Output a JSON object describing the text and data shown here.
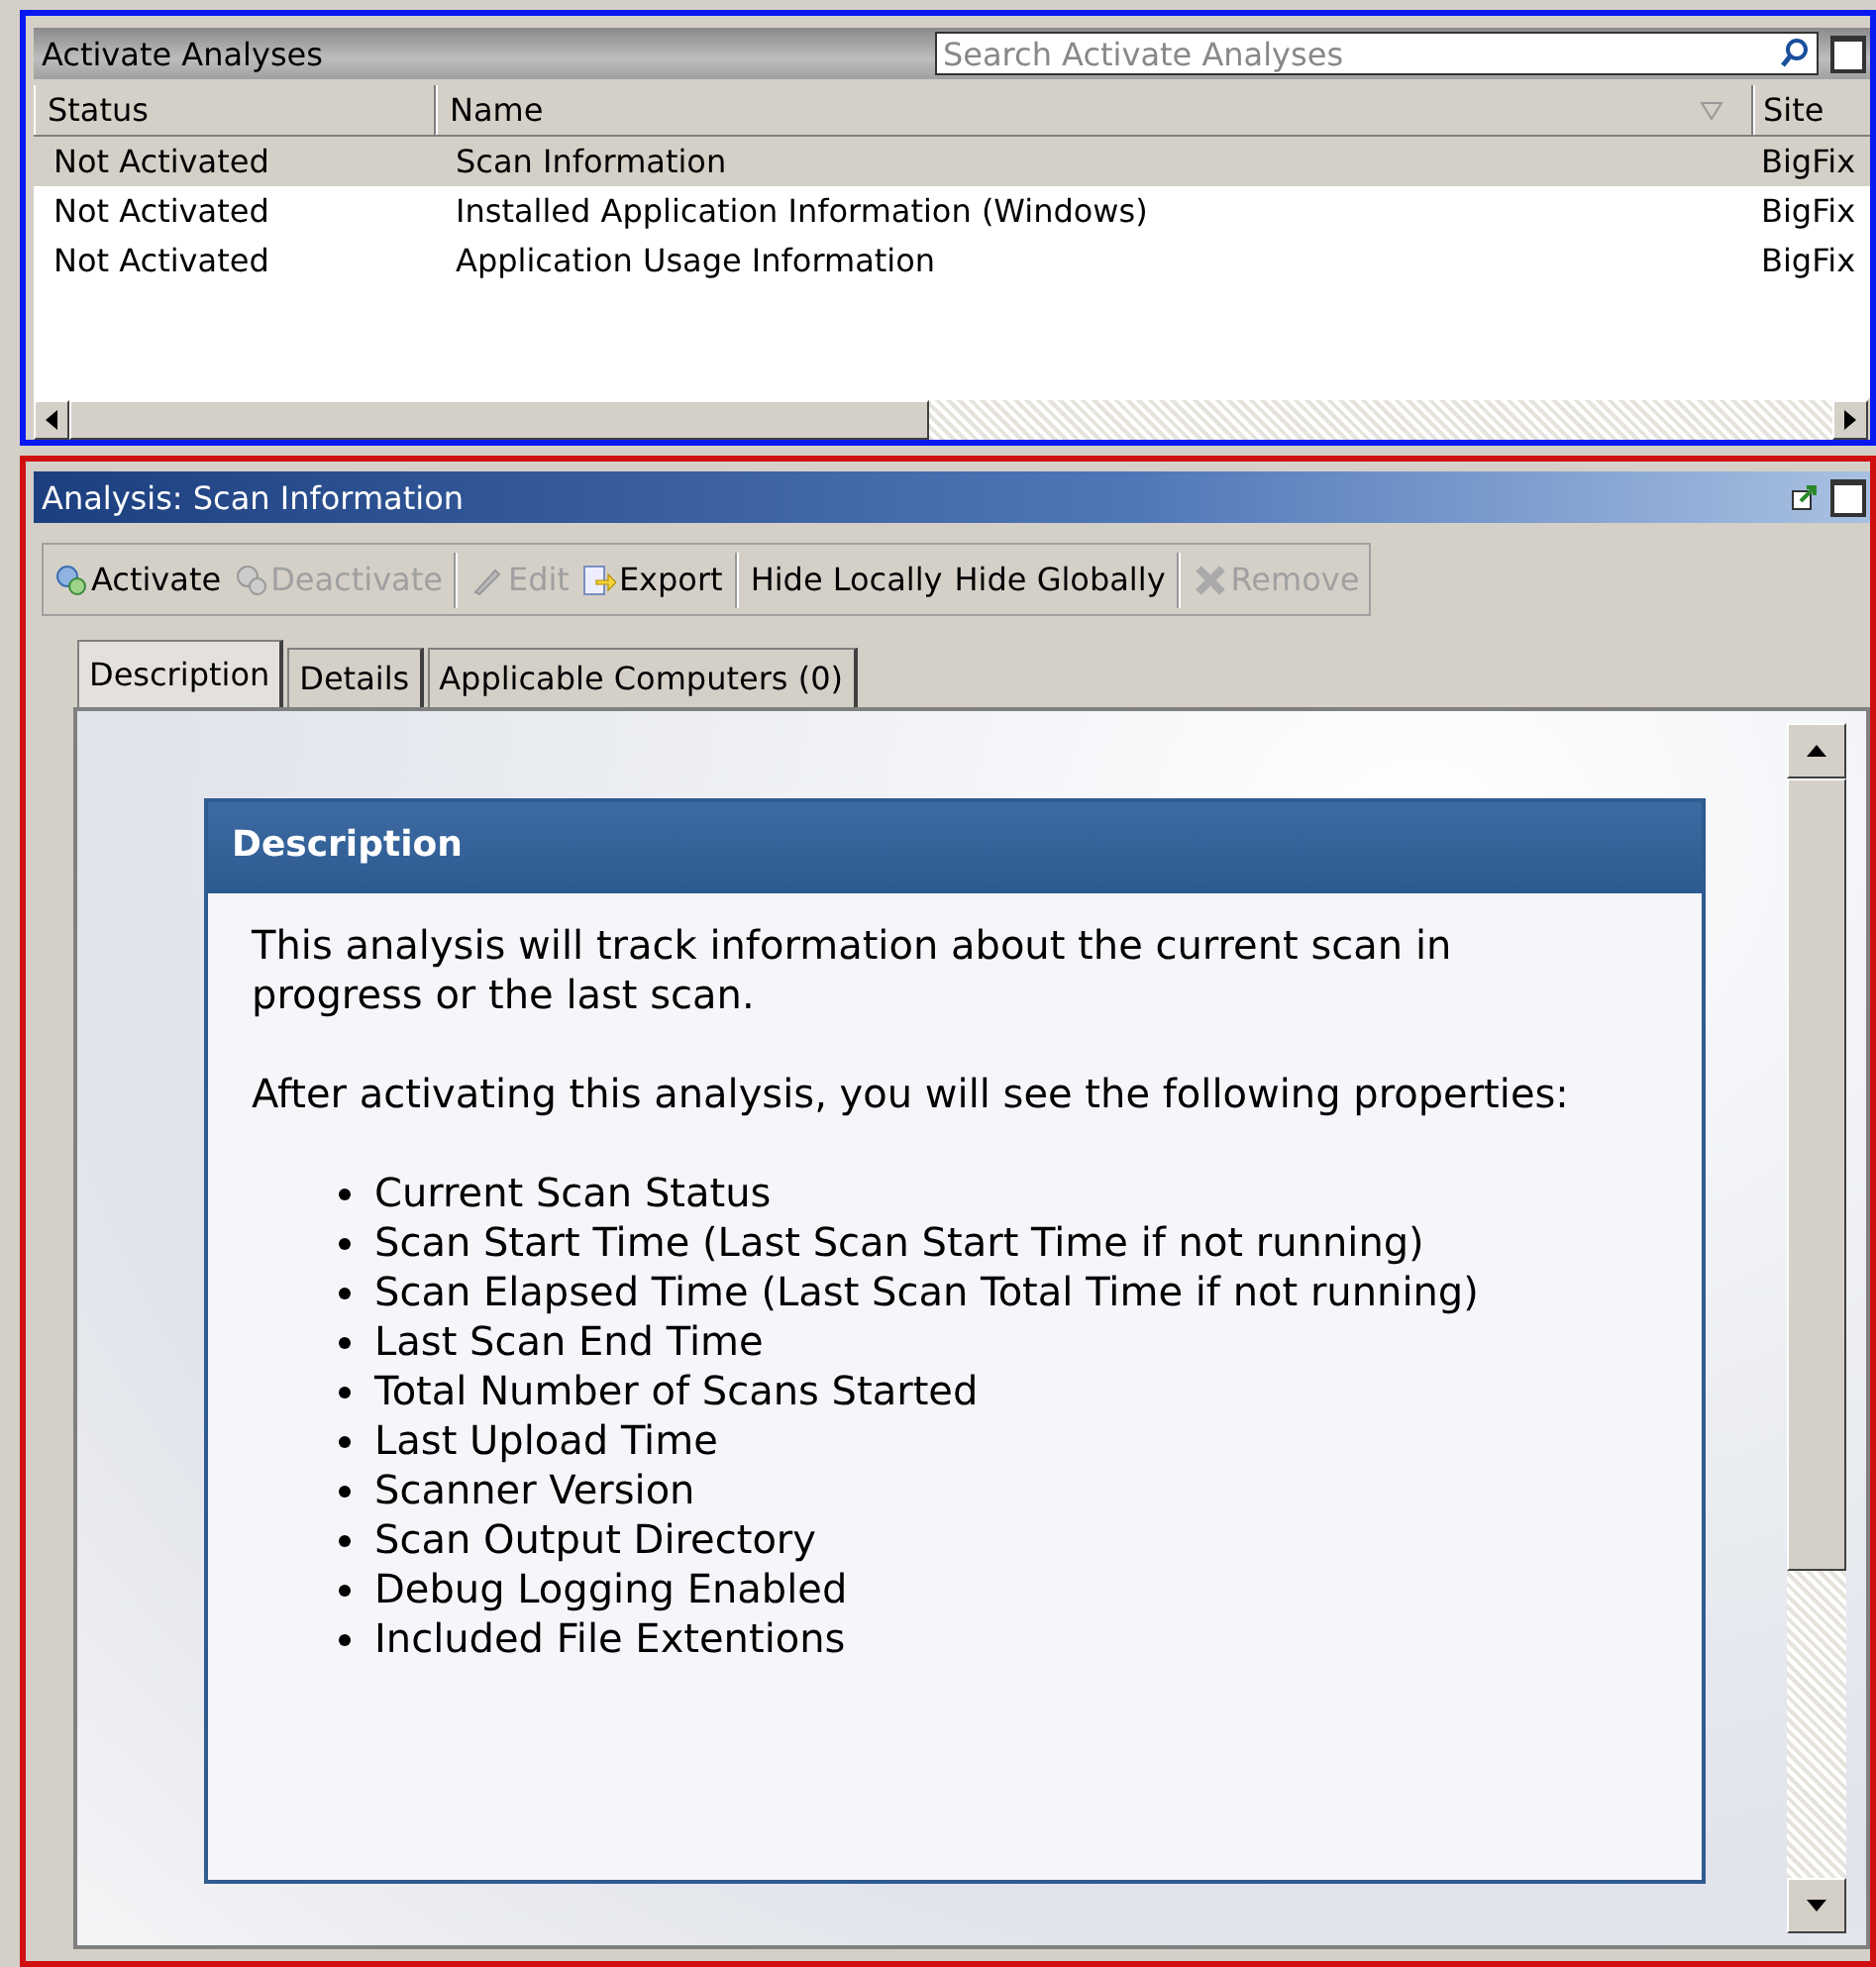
{
  "analyses_panel": {
    "title": "Activate Analyses",
    "search": {
      "placeholder": "Search Activate Analyses"
    },
    "table": {
      "columns": [
        {
          "label": "Status",
          "sorted": false
        },
        {
          "label": "Name",
          "sorted": true
        },
        {
          "label": "Site",
          "sorted": false
        }
      ],
      "rows": [
        {
          "cells": [
            "Not Activated",
            "Scan Information",
            "BigFix"
          ],
          "selected": true
        },
        {
          "cells": [
            "Not Activated",
            "Installed Application Information (Windows)",
            "BigFix"
          ],
          "selected": false
        },
        {
          "cells": [
            "Not Activated",
            "Application Usage Information",
            "BigFix"
          ],
          "selected": false
        }
      ]
    }
  },
  "analysis_panel": {
    "title": "Analysis: Scan Information",
    "toolbar": [
      {
        "kind": "icon-button",
        "label": "Activate",
        "disabled": false
      },
      {
        "kind": "icon-button",
        "label": "Deactivate",
        "disabled": true
      },
      {
        "kind": "separator"
      },
      {
        "kind": "icon-button",
        "label": "Edit",
        "disabled": true
      },
      {
        "kind": "icon-button",
        "label": "Export",
        "disabled": false
      },
      {
        "kind": "separator"
      },
      {
        "kind": "text-button",
        "label": "Hide Locally",
        "disabled": false
      },
      {
        "kind": "text-button",
        "label": "Hide Globally",
        "disabled": false
      },
      {
        "kind": "separator"
      },
      {
        "kind": "icon-button",
        "label": "Remove",
        "disabled": true
      }
    ],
    "tabs": [
      {
        "label": "Description",
        "selected": true
      },
      {
        "label": "Details",
        "selected": false
      },
      {
        "label": "Applicable Computers (0)",
        "selected": false
      }
    ],
    "description": {
      "heading": "Description",
      "paragraphs": [
        "This analysis will track information about the current scan in progress or the last scan.",
        "After activating this analysis, you will see the following properties:"
      ],
      "properties": [
        "Current Scan Status",
        "Scan Start Time (Last Scan Start Time if not running)",
        "Scan Elapsed Time (Last Scan Total Time if not running)",
        "Last Scan End Time",
        "Total Number of Scans Started",
        "Last Upload Time",
        "Scanner Version",
        "Scan Output Directory",
        "Debug Logging Enabled",
        "Included File Extentions"
      ]
    }
  }
}
